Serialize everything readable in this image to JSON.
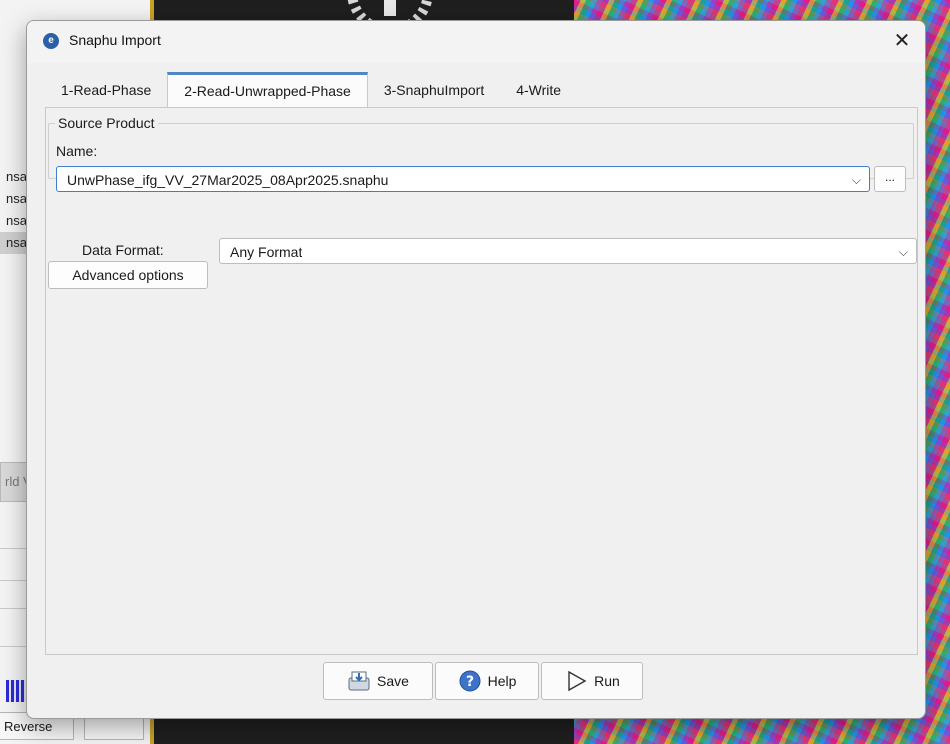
{
  "background": {
    "file_list": [
      "nsar",
      "nsar_",
      "nsar_",
      "nsar_"
    ],
    "world_tab_label": "rld V",
    "reverse_button_label": "Reverse"
  },
  "dialog": {
    "title": "Snaphu Import",
    "close_symbol": "✕",
    "tabs": [
      {
        "label": "1-Read-Phase",
        "active": false
      },
      {
        "label": "2-Read-Unwrapped-Phase",
        "active": true
      },
      {
        "label": "3-SnaphuImport",
        "active": false
      },
      {
        "label": "4-Write",
        "active": false
      }
    ],
    "source_product": {
      "group_title": "Source Product",
      "name_label": "Name:",
      "name_value": "UnwPhase_ifg_VV_27Mar2025_08Apr2025.snaphu",
      "browse_label": "..."
    },
    "data_format": {
      "label": "Data Format:",
      "value": "Any Format"
    },
    "advanced_options_label": "Advanced options",
    "buttons": {
      "save": "Save",
      "help": "Help",
      "run": "Run"
    }
  },
  "colors": {
    "accent": "#4f86c6",
    "focus_border": "#3c7fd0",
    "window_bg": "#f0f0f0"
  }
}
